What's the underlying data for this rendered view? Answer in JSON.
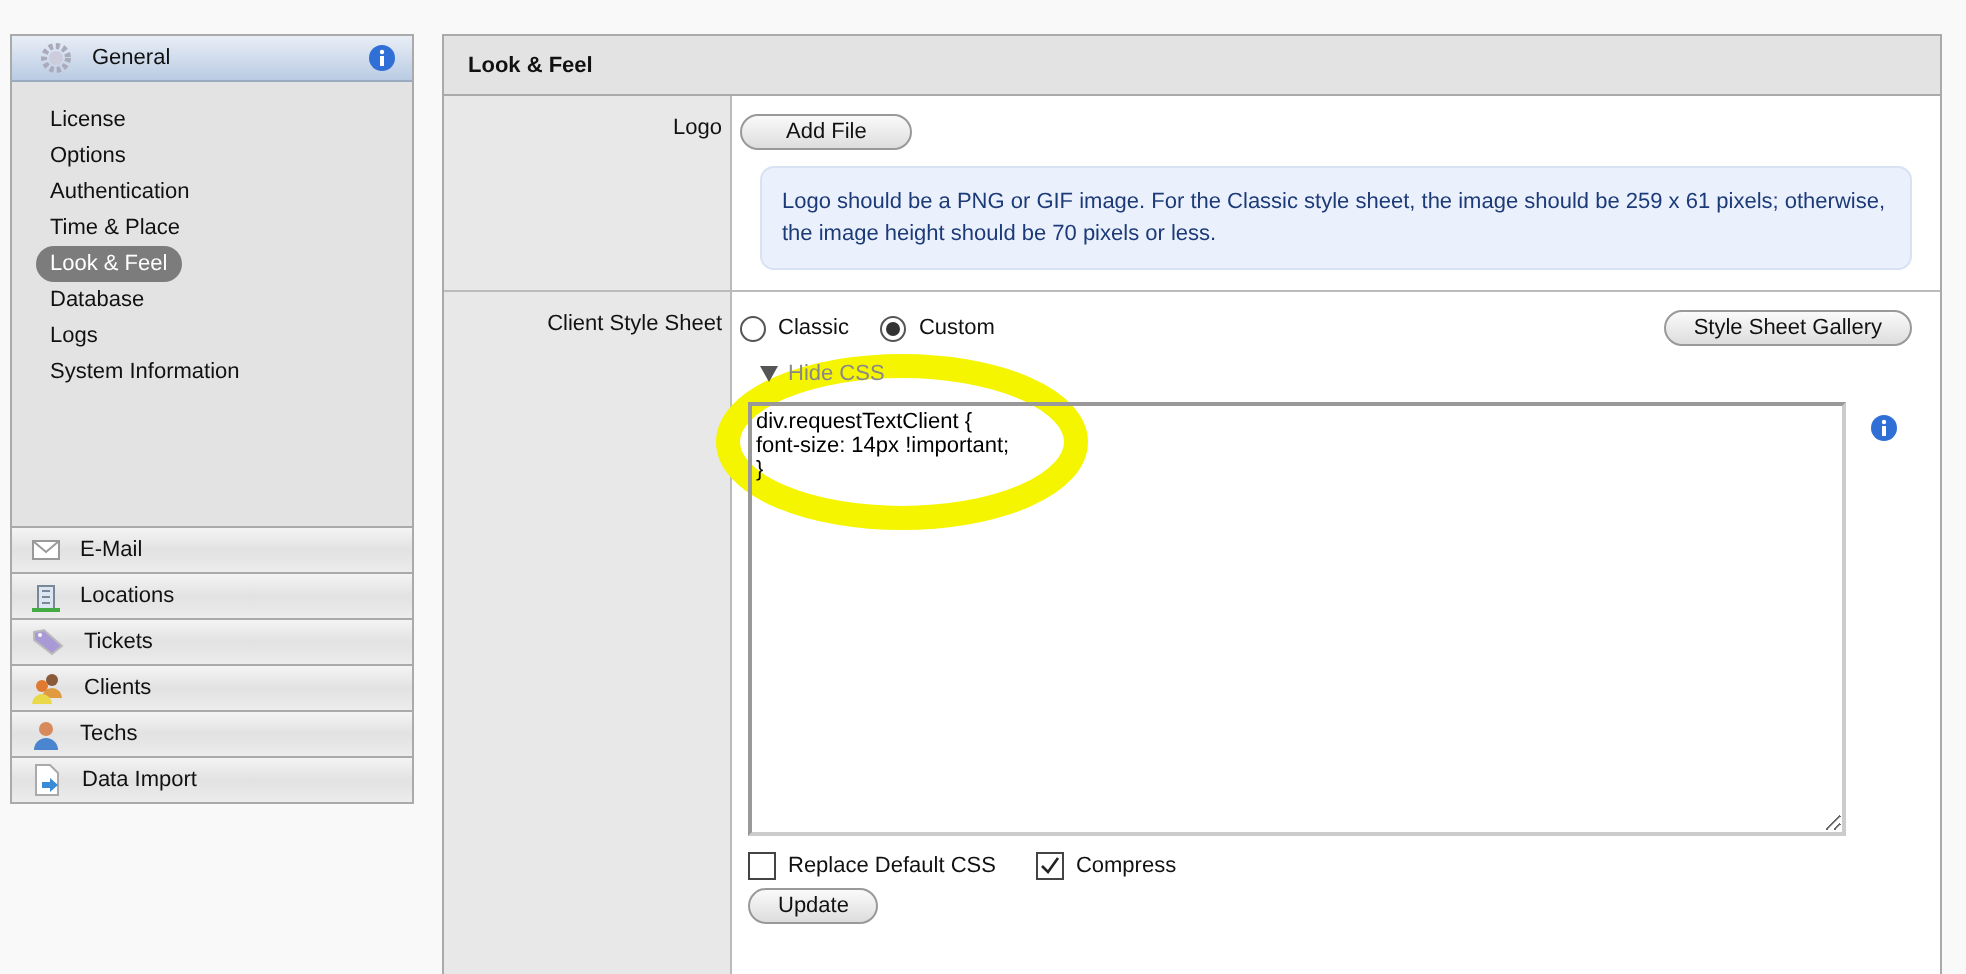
{
  "sidebar": {
    "header": {
      "title": "General"
    },
    "items": [
      {
        "label": "License",
        "selected": false
      },
      {
        "label": "Options",
        "selected": false
      },
      {
        "label": "Authentication",
        "selected": false
      },
      {
        "label": "Time & Place",
        "selected": false
      },
      {
        "label": "Look & Feel",
        "selected": true
      },
      {
        "label": "Database",
        "selected": false
      },
      {
        "label": "Logs",
        "selected": false
      },
      {
        "label": "System Information",
        "selected": false
      }
    ],
    "sections": [
      {
        "label": "E-Mail",
        "kind": "mail"
      },
      {
        "label": "Locations",
        "kind": "building"
      },
      {
        "label": "Tickets",
        "kind": "tag"
      },
      {
        "label": "Clients",
        "kind": "people"
      },
      {
        "label": "Techs",
        "kind": "person"
      },
      {
        "label": "Data Import",
        "kind": "import"
      }
    ]
  },
  "panel": {
    "title": "Look & Feel",
    "logo": {
      "label": "Logo",
      "button": "Add File",
      "note": "Logo should be a PNG or GIF image. For the Classic style sheet, the image should be 259 x 61 pixels; otherwise, the image height should be 70 pixels or less."
    },
    "style_sheet": {
      "label": "Client Style Sheet",
      "options": [
        {
          "label": "Classic",
          "selected": false
        },
        {
          "label": "Custom",
          "selected": true
        }
      ],
      "gallery_button": "Style Sheet Gallery",
      "toggle": "Hide CSS",
      "expanded": true,
      "css": "div.requestTextClient {\nfont-size: 14px !important;\n}",
      "checkboxes": [
        {
          "label": "Replace Default CSS",
          "checked": false
        },
        {
          "label": "Compress",
          "checked": true
        }
      ],
      "update_button": "Update"
    }
  }
}
